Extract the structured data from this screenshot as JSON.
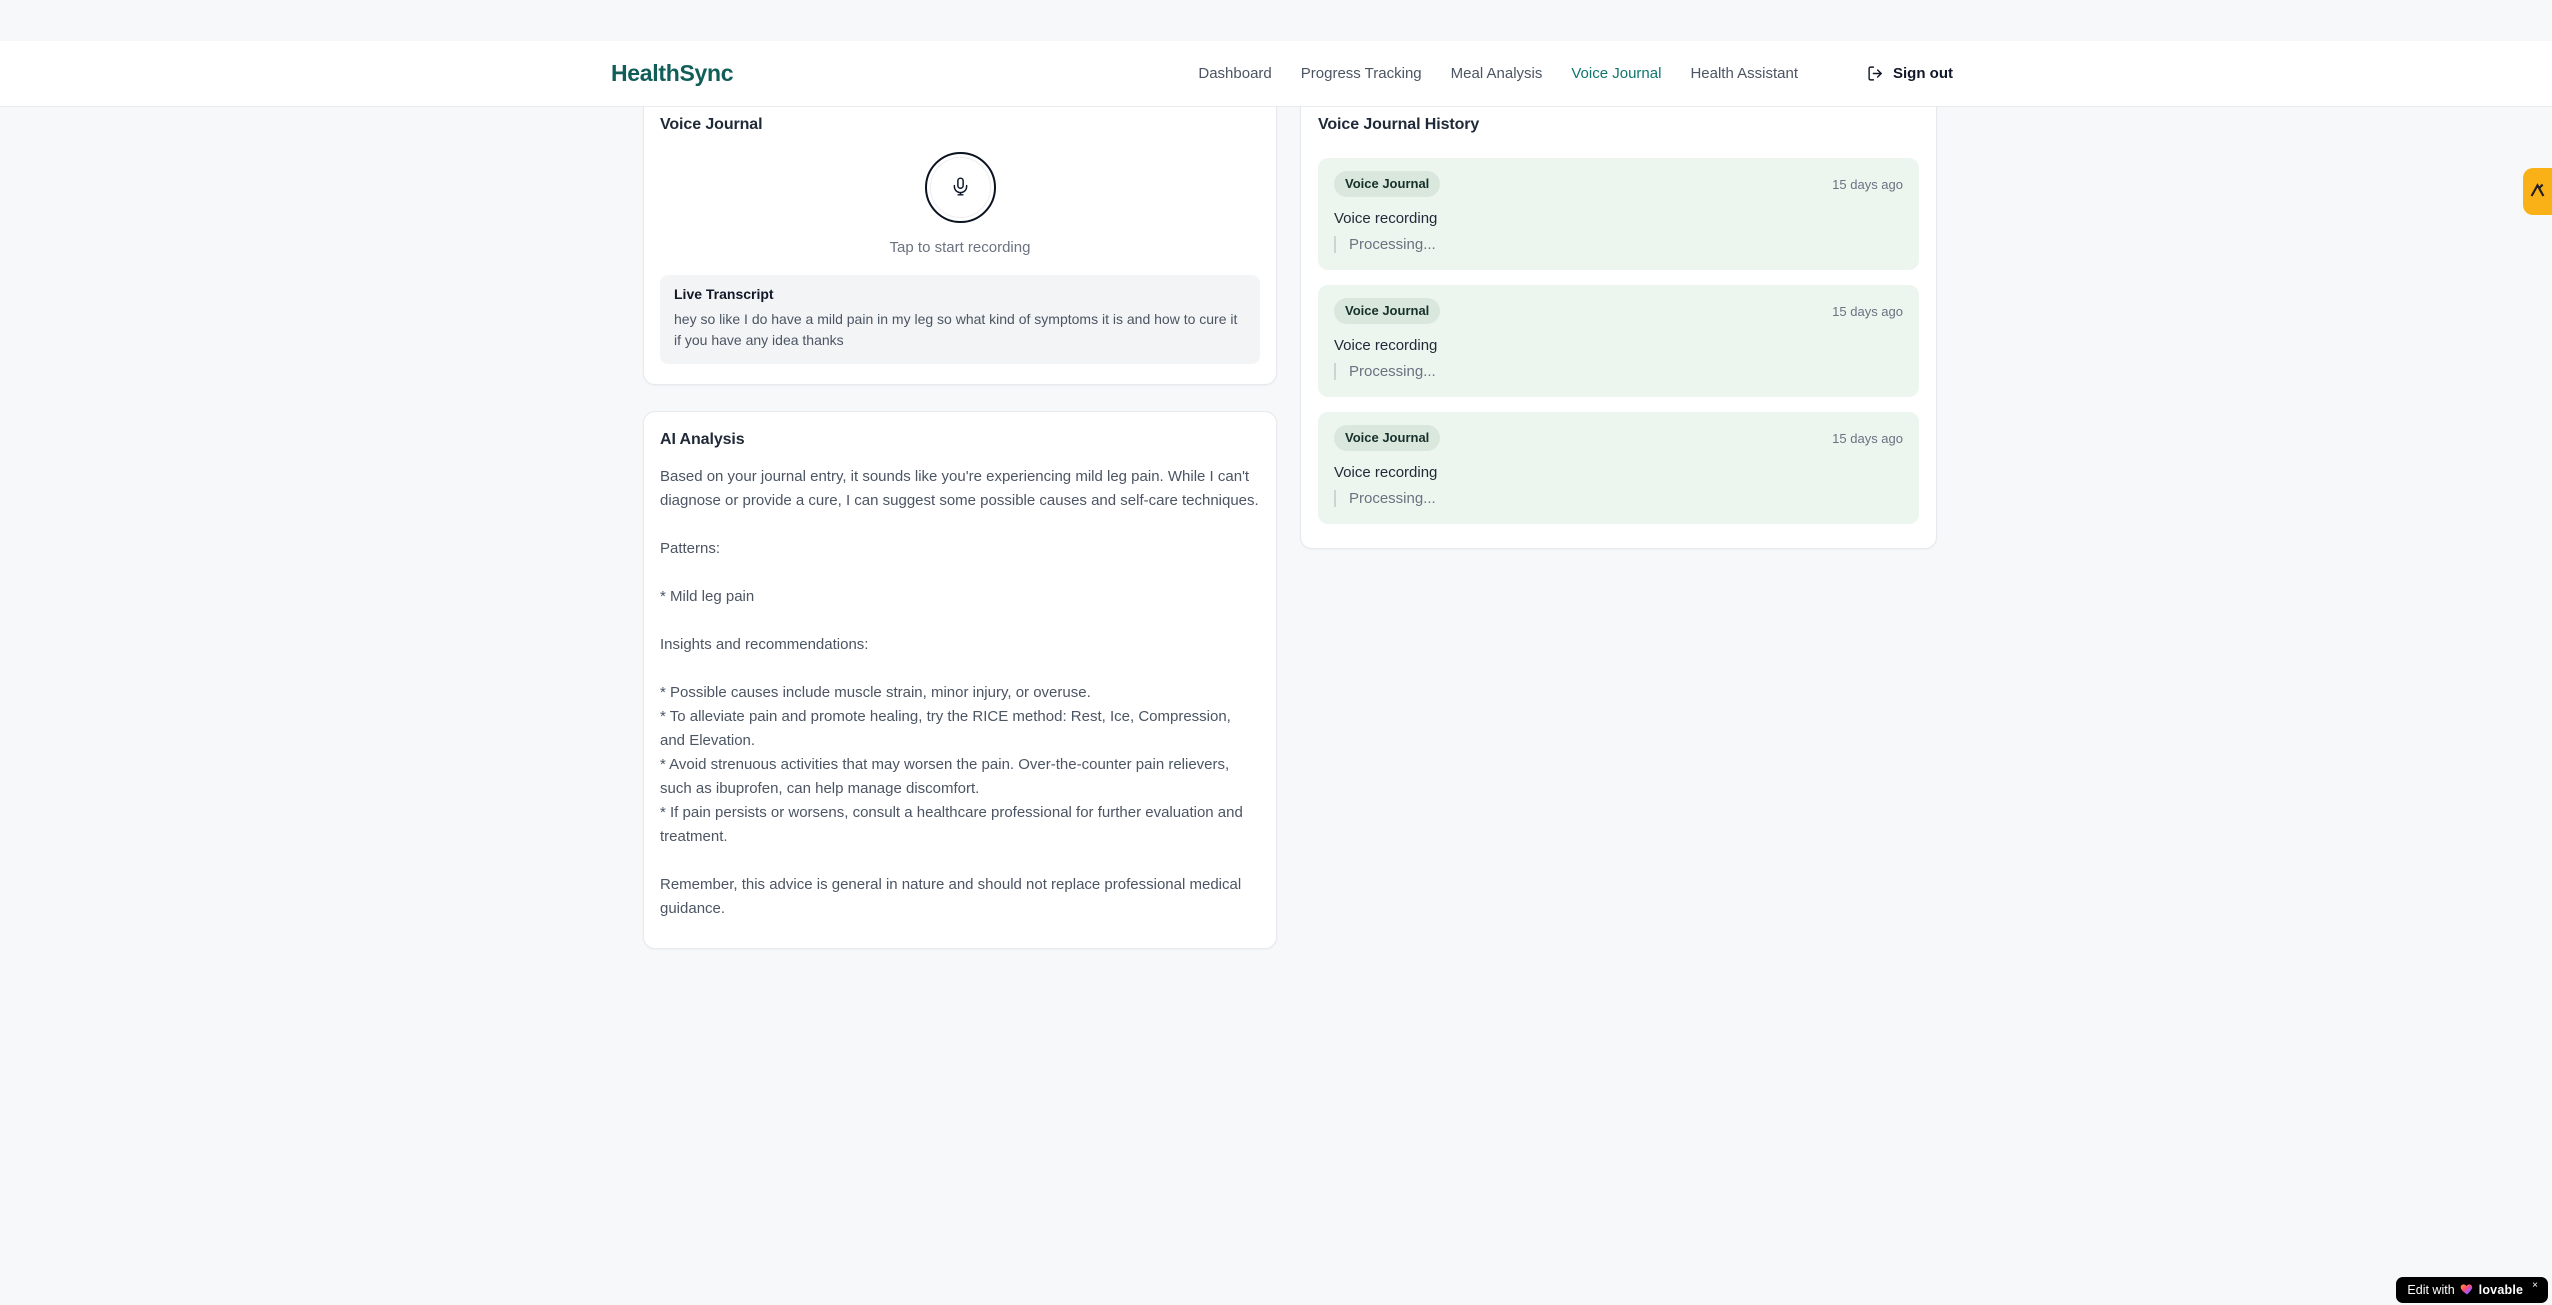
{
  "brand": "HealthSync",
  "nav": {
    "items": [
      {
        "label": "Dashboard",
        "active": false
      },
      {
        "label": "Progress Tracking",
        "active": false
      },
      {
        "label": "Meal Analysis",
        "active": false
      },
      {
        "label": "Voice Journal",
        "active": true
      },
      {
        "label": "Health Assistant",
        "active": false
      }
    ],
    "sign_out_label": "Sign out"
  },
  "page": {
    "title": "Voice Journal"
  },
  "recorder": {
    "card_title": "Voice Journal",
    "tap_hint": "Tap to start recording",
    "transcript": {
      "title": "Live Transcript",
      "text": "hey so like I do have a mild pain in my leg so what kind of symptoms it is and how to cure it if you have any idea thanks"
    }
  },
  "analysis": {
    "card_title": "AI Analysis",
    "paragraphs": [
      "Based on your journal entry, it sounds like you're experiencing mild leg pain. While I can't diagnose or provide a cure, I can suggest some possible causes and self-care techniques.",
      "Patterns:",
      "* Mild leg pain",
      "Insights and recommendations:",
      "* Possible causes include muscle strain, minor injury, or overuse.\n* To alleviate pain and promote healing, try the RICE method: Rest, Ice, Compression, and Elevation.\n* Avoid strenuous activities that may worsen the pain. Over-the-counter pain relievers, such as ibuprofen, can help manage discomfort.\n* If pain persists or worsens, consult a healthcare professional for further evaluation and treatment.",
      "Remember, this advice is general in nature and should not replace professional medical guidance."
    ]
  },
  "history": {
    "card_title": "Voice Journal History",
    "items": [
      {
        "badge": "Voice Journal",
        "time": "15 days ago",
        "title": "Voice recording",
        "status": "Processing..."
      },
      {
        "badge": "Voice Journal",
        "time": "15 days ago",
        "title": "Voice recording",
        "status": "Processing..."
      },
      {
        "badge": "Voice Journal",
        "time": "15 days ago",
        "title": "Voice recording",
        "status": "Processing..."
      }
    ]
  },
  "widgets": {
    "lovable": {
      "prefix": "Edit with",
      "brand": "lovable",
      "close": "×"
    }
  },
  "colors": {
    "brand": "#115e59",
    "nav_active": "#0f766e",
    "page_bg": "#f7f8fa",
    "history_item_bg": "#edf5ef",
    "badge_bg": "#d9e7dd",
    "side_tab_bg": "#f9b117"
  }
}
